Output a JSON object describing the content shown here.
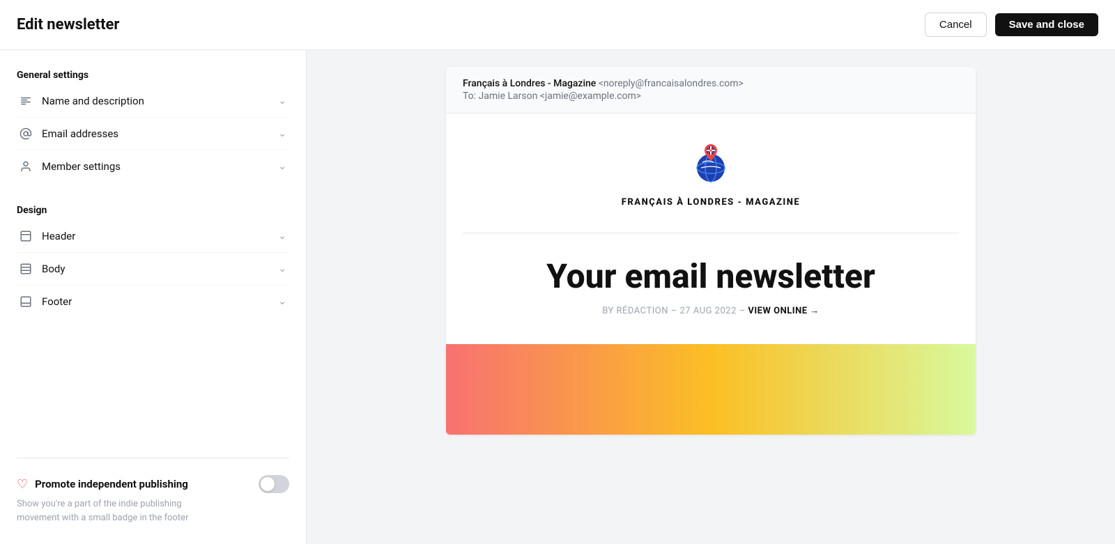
{
  "header": {
    "title": "Edit newsletter",
    "cancel_label": "Cancel",
    "save_label": "Save and close"
  },
  "sidebar": {
    "general_settings_label": "General settings",
    "design_label": "Design",
    "general_items": [
      {
        "id": "name-description",
        "label": "Name and description",
        "icon": "text-icon"
      },
      {
        "id": "email-addresses",
        "label": "Email addresses",
        "icon": "at-icon"
      },
      {
        "id": "member-settings",
        "label": "Member settings",
        "icon": "person-icon"
      }
    ],
    "design_items": [
      {
        "id": "header",
        "label": "Header",
        "icon": "header-layout-icon"
      },
      {
        "id": "body",
        "label": "Body",
        "icon": "body-layout-icon"
      },
      {
        "id": "footer",
        "label": "Footer",
        "icon": "footer-layout-icon"
      }
    ],
    "promote": {
      "title": "Promote independent publishing",
      "description": "Show you're a part of the indie publishing movement with a small badge in the footer",
      "enabled": false
    }
  },
  "preview": {
    "from_name": "Français à Londres - Magazine",
    "from_email": "<noreply@francaisalondres.com>",
    "to_label": "To:",
    "to_name": "Jamie Larson",
    "to_email": "<jamie@example.com>",
    "pub_name": "FRANÇAIS À LONDRES - MAGAZINE",
    "headline": "Your email newsletter",
    "byline_prefix": "BY RÉDACTION – 27 AUG 2022 –",
    "view_online": "VIEW ONLINE →"
  }
}
